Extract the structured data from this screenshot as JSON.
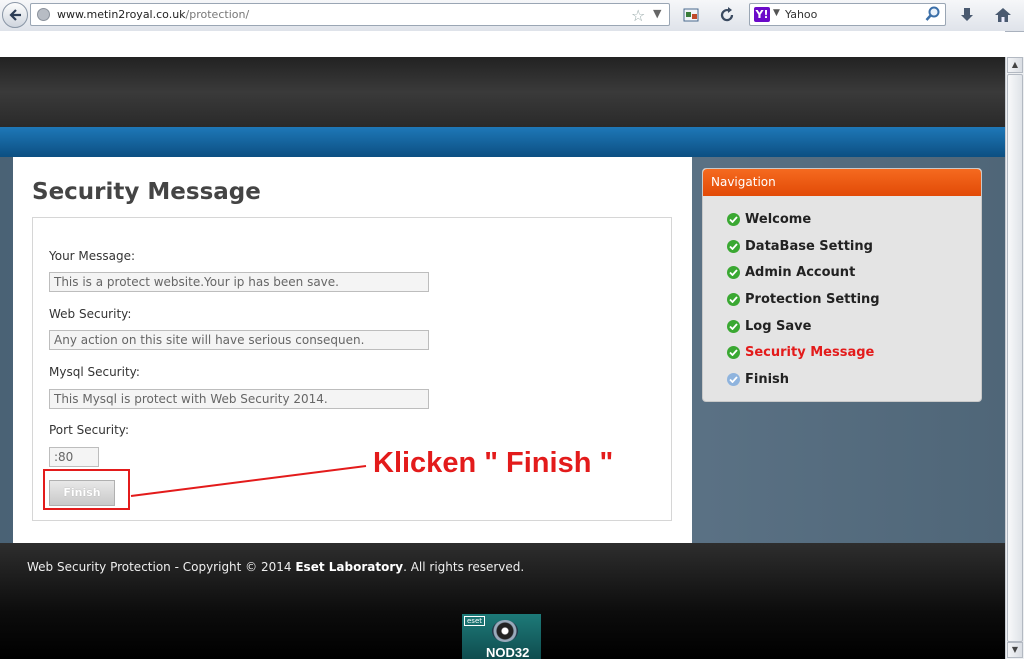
{
  "browser": {
    "url_host": "www.metin2royal.co.uk",
    "url_path": "/protection/",
    "search_engine": "Yahoo"
  },
  "page": {
    "title": "Security Message",
    "fields": [
      {
        "label": "Your Message:",
        "value": "This is a protect website.Your ip has been save."
      },
      {
        "label": "Web Security:",
        "value": "Any action on this site will have serious consequen."
      },
      {
        "label": "Mysql Security:",
        "value": "This Mysql is protect with Web Security 2014."
      },
      {
        "label": "Port Security:",
        "value": ":80"
      }
    ],
    "finish_button": "Finish",
    "annotation": "Klicken \" Finish \""
  },
  "navigation": {
    "heading": "Navigation",
    "items": [
      {
        "label": "Welcome",
        "status": "done"
      },
      {
        "label": "DataBase Setting",
        "status": "done"
      },
      {
        "label": "Admin Account",
        "status": "done"
      },
      {
        "label": "Protection Setting",
        "status": "done"
      },
      {
        "label": "Log Save",
        "status": "done"
      },
      {
        "label": "Security Message",
        "status": "active"
      },
      {
        "label": "Finish",
        "status": "pending"
      }
    ]
  },
  "footer": {
    "text_prefix": "Web Security Protection - Copyright © 2014 ",
    "company": "Eset Laboratory",
    "text_suffix": ". All rights reserved.",
    "badge_brand": "eset",
    "badge_product": "NOD32"
  },
  "colors": {
    "accent_red": "#e31b1b",
    "nav_header": "#e24a07",
    "blue_band": "#0c4f82"
  }
}
